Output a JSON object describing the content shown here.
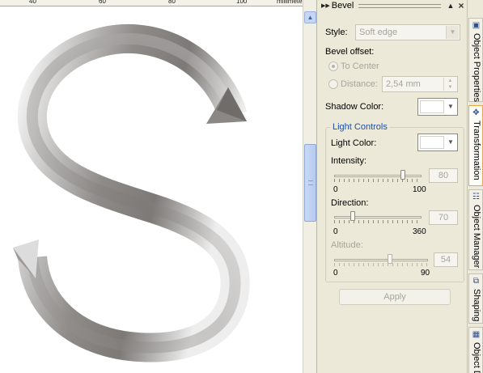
{
  "ruler": {
    "labels": [
      "40",
      "60",
      "80",
      "100"
    ],
    "unit": "millimeters"
  },
  "canvas": {
    "letter": "S",
    "letter_color_dark": "#7e7b78",
    "letter_color_light": "#f4f4f4"
  },
  "docker": {
    "title": "Bevel",
    "style_label": "Style:",
    "style_value": "Soft edge",
    "bevel_offset_label": "Bevel offset:",
    "to_center_label": "To Center",
    "distance_label": "Distance:",
    "distance_value": "2,54 mm",
    "shadow_color_label": "Shadow Color:",
    "light_controls_title": "Light Controls",
    "light_color_label": "Light Color:",
    "intensity": {
      "label": "Intensity:",
      "min": "0",
      "max": "100",
      "value": "80",
      "level": 80
    },
    "direction": {
      "label": "Direction:",
      "min": "0",
      "max": "360",
      "value": "70",
      "level": 70
    },
    "altitude": {
      "label": "Altitude:",
      "min": "0",
      "max": "90",
      "value": "54",
      "level": 54
    },
    "apply_label": "Apply"
  },
  "tabs": [
    {
      "label": "Object Properties",
      "icon": "object-properties-icon"
    },
    {
      "label": "Transformation",
      "icon": "transformation-icon"
    },
    {
      "label": "Object Manager",
      "icon": "object-manager-icon"
    },
    {
      "label": "Shaping",
      "icon": "shaping-icon"
    },
    {
      "label": "Object D",
      "icon": "object-data-icon"
    }
  ],
  "accent_colors": {
    "group_title": "#1f4ea5",
    "active_tab_border": "#e9a54a"
  }
}
